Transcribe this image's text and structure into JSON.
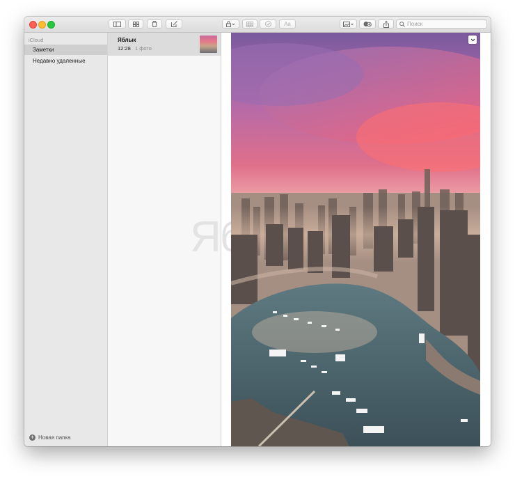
{
  "toolbar": {
    "search_placeholder": "Поиск",
    "format_label": "Aa"
  },
  "sidebar": {
    "account": "iCloud",
    "folders": [
      {
        "label": "Заметки",
        "selected": true
      },
      {
        "label": "Недавно удаленные",
        "selected": false
      }
    ],
    "new_folder_label": "Новая папка"
  },
  "notes": [
    {
      "title": "Яблык",
      "time": "12:28",
      "subtitle": "1 фото"
    }
  ],
  "editor": {
    "ghost_text": "Яб",
    "attachment_icon": "chevron-down-icon"
  },
  "colors": {
    "close": "#fe5f57",
    "minimize": "#febc2e",
    "zoom": "#28c840",
    "selection": "#cfcfcf"
  }
}
